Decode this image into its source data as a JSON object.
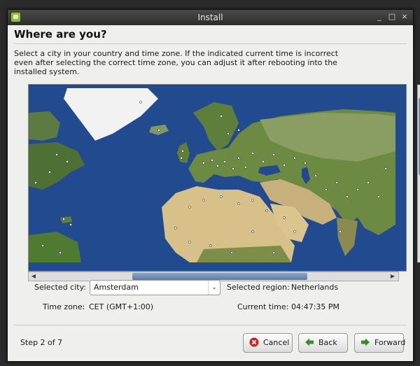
{
  "window": {
    "title": "Install"
  },
  "page": {
    "heading": "Where are you?",
    "description": "Select a city in your country and time zone. If the indicated current time is incorrect even after selecting the correct time zone, you can adjust it after rebooting into the installed system."
  },
  "selection": {
    "city_label": "Selected city:",
    "city_value": "Amsterdam",
    "region_label": "Selected region:",
    "region_value": "Netherlands",
    "timezone_label": "Time zone:",
    "timezone_value": "CET (GMT+1:00)",
    "current_time_label": "Current time:",
    "current_time_value": "04:47:35 PM"
  },
  "footer": {
    "step": "Step 2 of 7",
    "cancel_label": "Cancel",
    "back_label": "Back",
    "forward_label": "Forward"
  },
  "colors": {
    "ocean": "#214a8f",
    "cancel_icon": "#cc2222",
    "nav_icon": "#3d8a2b"
  },
  "icons": {
    "app": "install-app-icon",
    "cancel": "cancel-icon",
    "back": "back-arrow-icon",
    "forward": "forward-arrow-icon"
  }
}
